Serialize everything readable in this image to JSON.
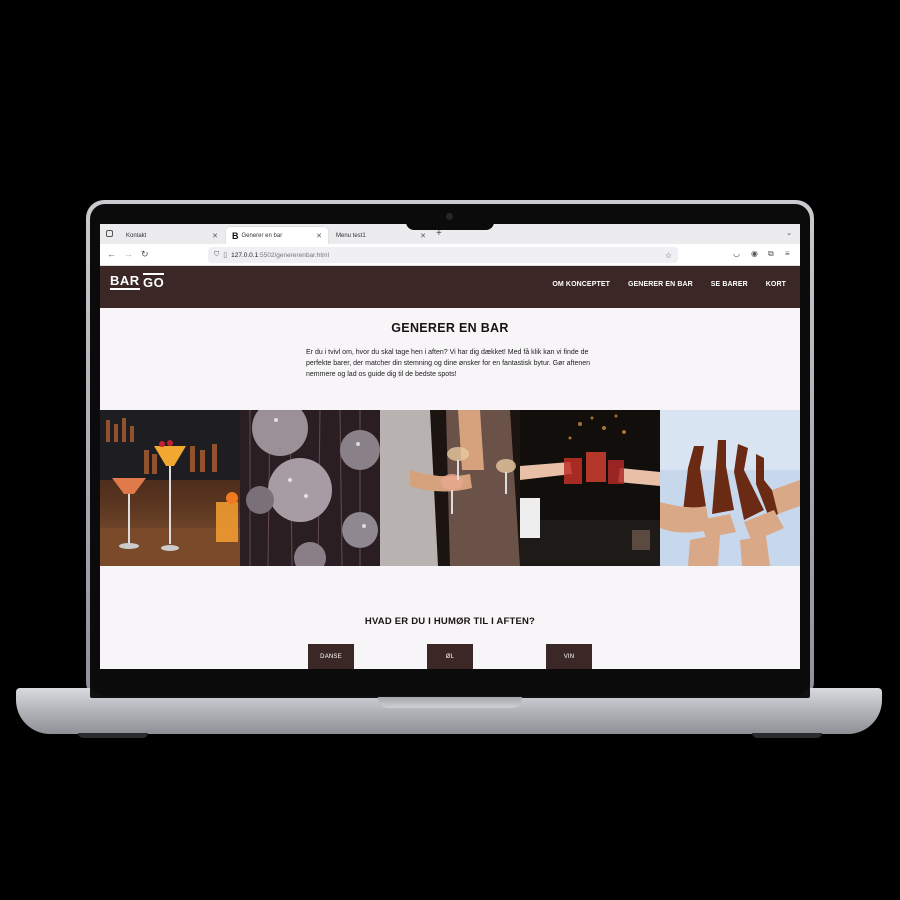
{
  "browser": {
    "tabs": [
      {
        "label": "Kontakt",
        "active": false
      },
      {
        "label": "Generer en bar",
        "active": true,
        "favicon": "B"
      },
      {
        "label": "Menu test1",
        "active": false
      }
    ],
    "new_tab": "+",
    "address_host": "127.0.0.1",
    "address_rest": ":5502/genererenbar.html"
  },
  "site": {
    "logo_top": "BAR",
    "logo_bottom": "GO",
    "nav": [
      "OM KONCEPTET",
      "GENERER EN BAR",
      "SE BARER",
      "KORT"
    ],
    "title": "GENERER EN BAR",
    "intro": "Er du i tvivl om, hvor du skal tage hen i aften? Vi har dig dækket! Med få klik kan vi finde de perfekte barer, der matcher din stemning og dine ønsker for en fantastisk bytur. Gør aftenen nemmere og lad os guide dig til de bedste spots!",
    "mood_heading": "HVAD ER DU I HUMØR TIL I AFTEN?",
    "buttons": [
      "DANSE",
      "ØL",
      "VIN"
    ]
  },
  "colors": {
    "brand": "#3c2727",
    "page_bg": "#f7f5f7",
    "text": "#1b1214"
  }
}
